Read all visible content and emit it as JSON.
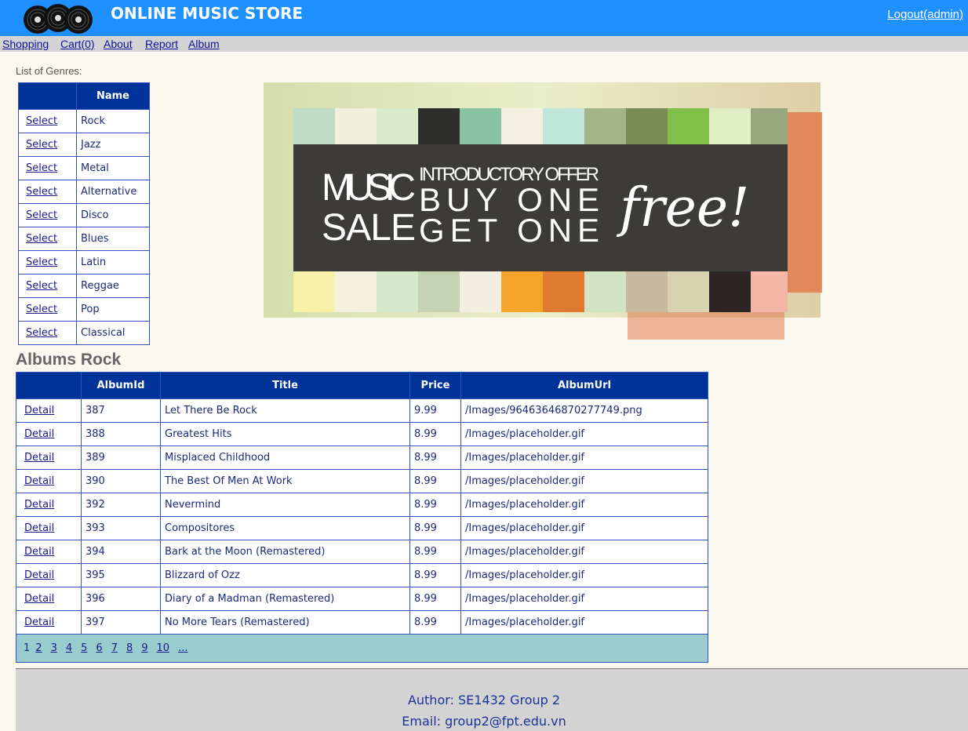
{
  "header": {
    "site_title": "ONLINE MUSIC STORE",
    "logout_label": "Logout(admin)",
    "bg_color": "#1e90ff"
  },
  "nav": {
    "items": [
      "Shopping",
      "Cart(0)",
      "About",
      "Report",
      "Album"
    ]
  },
  "genres": {
    "caption": "List of Genres:",
    "column_header": "Name",
    "select_label": "Select",
    "items": [
      "Rock",
      "Jazz",
      "Metal",
      "Alternative",
      "Disco",
      "Blues",
      "Latin",
      "Reggae",
      "Pop",
      "Classical"
    ]
  },
  "banner": {
    "line_music": "MUSIC",
    "line_sale": "SALE",
    "line_offer": "INTRODUCTORY OFFER",
    "line_buy": "BUY ONE",
    "line_get": "GET ONE",
    "line_free": "free!"
  },
  "albums": {
    "title": "Albums Rock",
    "columns": [
      "",
      "AlbumId",
      "Title",
      "Price",
      "AlbumUrl"
    ],
    "detail_label": "Detail",
    "rows": [
      {
        "id": "387",
        "title": "Let There Be Rock",
        "price": "9.99",
        "url": "/Images/96463646870277749.png"
      },
      {
        "id": "388",
        "title": "Greatest Hits",
        "price": "8.99",
        "url": "/Images/placeholder.gif"
      },
      {
        "id": "389",
        "title": "Misplaced Childhood",
        "price": "8.99",
        "url": "/Images/placeholder.gif"
      },
      {
        "id": "390",
        "title": "The Best Of Men At Work",
        "price": "8.99",
        "url": "/Images/placeholder.gif"
      },
      {
        "id": "392",
        "title": "Nevermind",
        "price": "8.99",
        "url": "/Images/placeholder.gif"
      },
      {
        "id": "393",
        "title": "Compositores",
        "price": "8.99",
        "url": "/Images/placeholder.gif"
      },
      {
        "id": "394",
        "title": "Bark at the Moon (Remastered)",
        "price": "8.99",
        "url": "/Images/placeholder.gif"
      },
      {
        "id": "395",
        "title": "Blizzard of Ozz",
        "price": "8.99",
        "url": "/Images/placeholder.gif"
      },
      {
        "id": "396",
        "title": "Diary of a Madman (Remastered)",
        "price": "8.99",
        "url": "/Images/placeholder.gif"
      },
      {
        "id": "397",
        "title": "No More Tears (Remastered)",
        "price": "8.99",
        "url": "/Images/placeholder.gif"
      }
    ],
    "pager": {
      "current": "1",
      "pages": [
        "2",
        "3",
        "4",
        "5",
        "6",
        "7",
        "8",
        "9",
        "10",
        "..."
      ]
    }
  },
  "footer": {
    "author": "Author: SE1432 Group 2",
    "email": "Email: group2@fpt.edu.vn"
  },
  "colors": {
    "table_header": "#003399",
    "pager_bg": "#99cccc",
    "nav_bg": "#d3d3d3",
    "page_bg": "#fbf8f0"
  }
}
